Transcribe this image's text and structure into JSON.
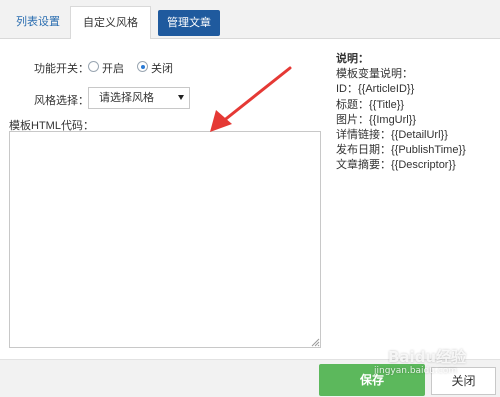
{
  "tabs": [
    {
      "label": "列表设置"
    },
    {
      "label": "自定义风格"
    },
    {
      "label": "管理文章"
    }
  ],
  "form": {
    "switch_label": "功能开关：",
    "switch_options": [
      {
        "label": "开启",
        "checked": false
      },
      {
        "label": "关闭",
        "checked": true
      }
    ],
    "style_label": "风格选择：",
    "style_select_value": "请选择风格",
    "template_label": "模板HTML代码：",
    "template_value": ""
  },
  "help": {
    "title": "说明：",
    "lines": [
      "模板变量说明：",
      "ID：{{ArticleID}}",
      "标题：{{Title}}",
      "图片：{{ImgUrl}}",
      "详情链接：{{DetailUrl}}",
      "发布日期：{{PublishTime}}",
      "文章摘要：{{Descriptor}}"
    ]
  },
  "footer": {
    "save_label": "保存",
    "close_label": "关闭"
  },
  "watermark": {
    "text": "Baidu经验",
    "url": "jingyan.baidu.com"
  },
  "colors": {
    "tab_active_bg": "#1f5a9e",
    "save_bg": "#5cb85c",
    "annotation_arrow": "#e53935",
    "link_blue": "#2a6db0"
  }
}
